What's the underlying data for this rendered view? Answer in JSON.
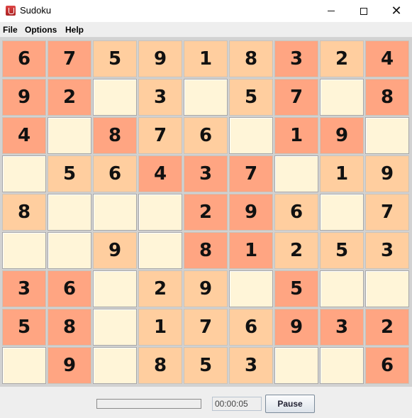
{
  "window": {
    "title": "Sudoku"
  },
  "menu": [
    "File",
    "Options",
    "Help"
  ],
  "colors": {
    "empty": "#fff5d8",
    "light": "#ffce9f",
    "dark": "#ffa582"
  },
  "board": [
    [
      "6",
      "7",
      "5",
      "9",
      "1",
      "8",
      "3",
      "2",
      "4"
    ],
    [
      "9",
      "2",
      "",
      "3",
      "",
      "5",
      "7",
      "",
      "8"
    ],
    [
      "4",
      "",
      "8",
      "7",
      "6",
      "",
      "1",
      "9",
      ""
    ],
    [
      "",
      "5",
      "6",
      "4",
      "3",
      "7",
      "",
      "1",
      "9"
    ],
    [
      "8",
      "",
      "",
      "",
      "2",
      "9",
      "6",
      "",
      "7"
    ],
    [
      "",
      "",
      "9",
      "",
      "8",
      "1",
      "2",
      "5",
      "3"
    ],
    [
      "3",
      "6",
      "",
      "2",
      "9",
      "",
      "5",
      "",
      ""
    ],
    [
      "5",
      "8",
      "",
      "1",
      "7",
      "6",
      "9",
      "3",
      "2"
    ],
    [
      "",
      "9",
      "",
      "8",
      "5",
      "3",
      "",
      "",
      "6"
    ]
  ],
  "shading": [
    [
      2,
      2,
      1,
      1,
      1,
      1,
      2,
      1,
      2
    ],
    [
      2,
      2,
      0,
      1,
      0,
      1,
      2,
      0,
      2
    ],
    [
      2,
      0,
      2,
      1,
      1,
      0,
      2,
      2,
      0
    ],
    [
      0,
      1,
      1,
      2,
      2,
      2,
      0,
      1,
      1
    ],
    [
      1,
      0,
      0,
      0,
      2,
      2,
      1,
      0,
      1
    ],
    [
      0,
      0,
      1,
      0,
      2,
      2,
      1,
      1,
      1
    ],
    [
      2,
      2,
      0,
      1,
      1,
      0,
      2,
      0,
      0
    ],
    [
      2,
      2,
      0,
      1,
      1,
      1,
      2,
      2,
      2
    ],
    [
      0,
      2,
      0,
      1,
      1,
      1,
      0,
      0,
      2
    ]
  ],
  "status": {
    "progress": 0,
    "timer": "00:00:05",
    "pause_label": "Pause"
  }
}
